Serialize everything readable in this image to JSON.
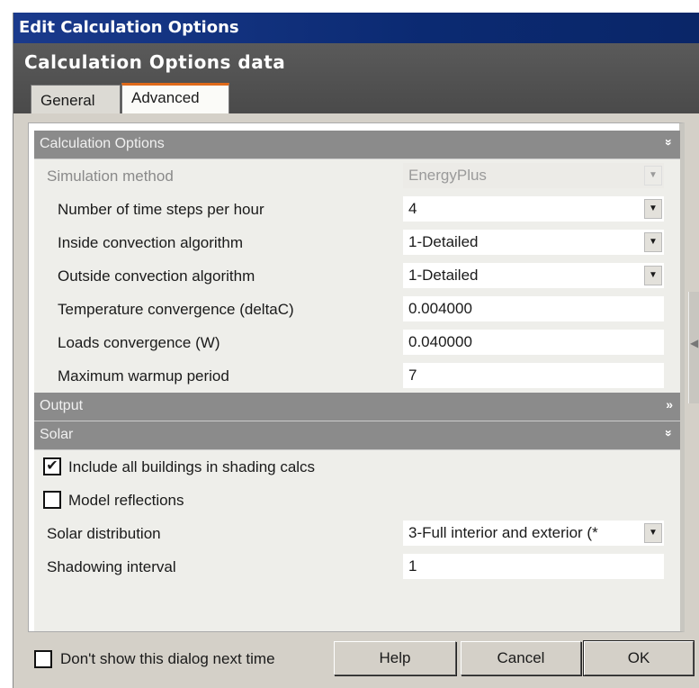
{
  "window": {
    "title": "Edit Calculation Options"
  },
  "header": {
    "title": "Calculation Options data"
  },
  "tabs": [
    {
      "label": "General"
    },
    {
      "label": "Advanced"
    }
  ],
  "sections": {
    "calc": {
      "label": "Calculation Options",
      "chevron": "»"
    },
    "output": {
      "label": "Output",
      "chevron": "»"
    },
    "solar": {
      "label": "Solar",
      "chevron": "»"
    }
  },
  "calc_rows": {
    "sim_method": {
      "label": "Simulation method",
      "value": "EnergyPlus"
    },
    "time_steps": {
      "label": "Number of time steps per hour",
      "value": "4"
    },
    "inside_conv": {
      "label": "Inside convection algorithm",
      "value": "1-Detailed"
    },
    "outside_conv": {
      "label": "Outside convection algorithm",
      "value": "1-Detailed"
    },
    "temp_conv": {
      "label": "Temperature convergence (deltaC)",
      "value": "0.004000"
    },
    "loads_conv": {
      "label": "Loads convergence (W)",
      "value": "0.040000"
    },
    "warmup": {
      "label": "Maximum warmup period",
      "value": "7"
    }
  },
  "solar_rows": {
    "include_buildings": {
      "label": "Include all buildings in shading calcs",
      "checked": "✔"
    },
    "model_reflections": {
      "label": "Model reflections"
    },
    "solar_distribution": {
      "label": "Solar distribution",
      "value": "3-Full interior and exterior (*"
    },
    "shadowing_interval": {
      "label": "Shadowing interval",
      "value": "1"
    }
  },
  "footer": {
    "dont_show": "Don't show this dialog next time",
    "help": "Help",
    "cancel": "Cancel",
    "ok": "OK"
  },
  "icons": {
    "dropdown": "▼",
    "scroll_arrow": "◀"
  },
  "colors": {
    "titlebar": "#0b2a72",
    "tab_accent": "#e06a1a",
    "section_bar": "#8b8b8b"
  }
}
